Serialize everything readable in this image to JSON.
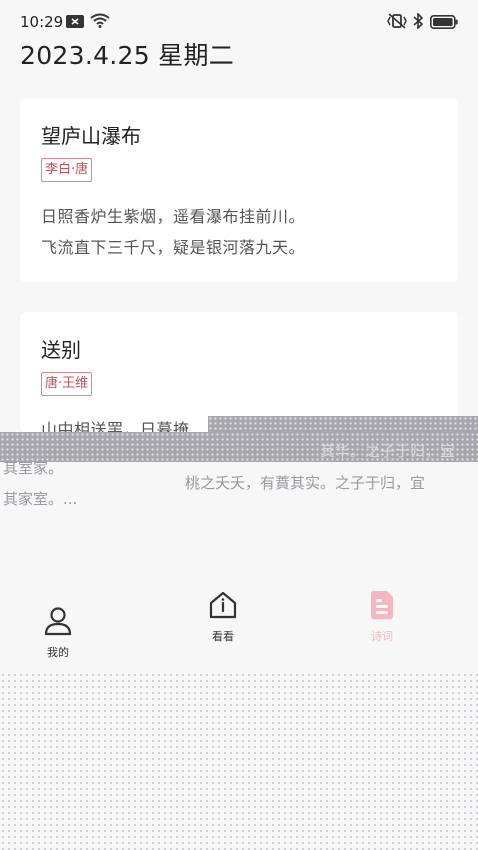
{
  "status_bar": {
    "time": "10:29"
  },
  "header": {
    "date": "2023.4.25 星期二"
  },
  "poems": [
    {
      "title": "望庐山瀑布",
      "author": "李白·唐",
      "lines": [
        "日照香炉生紫烟，遥看瀑布挂前川。",
        "飞流直下三千尺，疑是银河落九天。"
      ]
    },
    {
      "title": "送别",
      "author": "唐·王维",
      "lines": [
        "山中相送罢，日暮掩"
      ]
    }
  ],
  "ghost": {
    "line_a": "其室家。",
    "line_b": "其家室。...",
    "line_c": "桃之夭夭，有蕡其实。之子于归，宜",
    "line_d": "其华。之子于归，宜"
  },
  "nav": {
    "items": [
      {
        "label": "我的",
        "icon": "person-icon"
      },
      {
        "label": "看看",
        "icon": "home-icon"
      },
      {
        "label": "诗词",
        "icon": "document-icon",
        "active": true
      }
    ]
  },
  "colors": {
    "accent": "#c4505a",
    "active_icon": "#f4b7c0",
    "background": "#f7f7f8"
  }
}
